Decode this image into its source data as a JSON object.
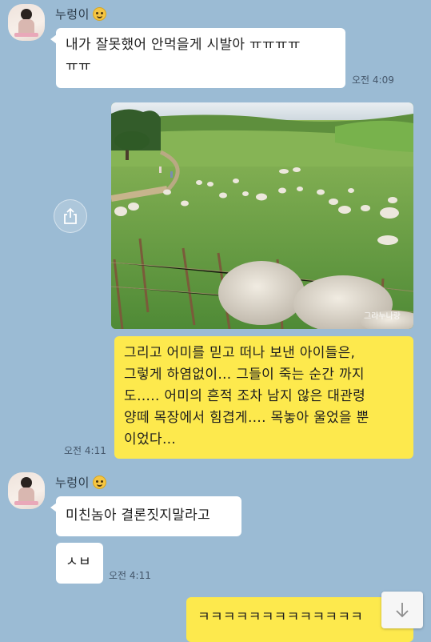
{
  "contact": {
    "name": "누렁이"
  },
  "messages": [
    {
      "from": "contact",
      "lines": [
        "내가 잘못했어 안먹을게 시발아 ㅠㅠㅠㅠ",
        "ㅠㅠ"
      ],
      "time": "오전 4:09"
    },
    {
      "from": "me",
      "type": "photo",
      "watermark": "그라누나랑"
    },
    {
      "from": "me",
      "lines": [
        "그리고 어미를 믿고 떠나 보낸 아이들은,",
        "그렇게 하염없이… 그들이 죽는 순간 까지",
        "도….. 어미의 흔적 조차 남지 않은 대관령",
        "양떼 목장에서 힘겹게…. 목놓아 울었을 뿐",
        "이었다…"
      ],
      "time": "오전 4:11"
    },
    {
      "from": "contact",
      "lines": [
        "미친놈아 결론짓지말라고"
      ]
    },
    {
      "from": "contact",
      "lines": [
        "ㅅㅂ"
      ],
      "time": "오전 4:11"
    },
    {
      "from": "me",
      "lines": [
        "ㅋㅋㅋㅋㅋㅋㅋㅋㅋㅋㅋㅋㅋ"
      ]
    }
  ],
  "icons": {
    "share": "share-icon",
    "scroll": "arrow-down-icon",
    "reaction": "smiley-emoji"
  },
  "colors": {
    "background": "#9bbbd4",
    "my_bubble": "#fde94d",
    "their_bubble": "#ffffff"
  }
}
